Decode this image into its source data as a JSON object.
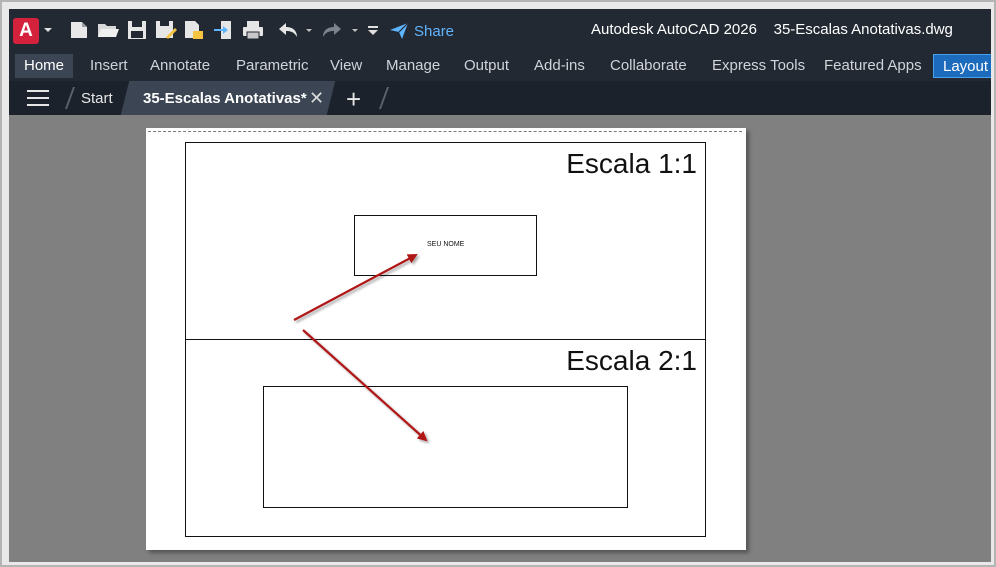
{
  "app": {
    "logo_letter": "A",
    "title": "Autodesk AutoCAD 2026",
    "filename": "35-Escalas Anotativas.dwg",
    "brand_color": "#d4223c",
    "accent_color": "#1c6bbd"
  },
  "quick_access": {
    "icons": [
      "new-file-icon",
      "open-folder-icon",
      "save-icon",
      "save-as-icon",
      "publish-icon",
      "import-icon",
      "print-icon",
      "undo-icon",
      "redo-icon",
      "customize-icon"
    ],
    "share_label": "Share"
  },
  "ribbon": {
    "tabs": [
      {
        "label": "Home"
      },
      {
        "label": "Insert"
      },
      {
        "label": "Annotate"
      },
      {
        "label": "Parametric"
      },
      {
        "label": "View"
      },
      {
        "label": "Manage"
      },
      {
        "label": "Output"
      },
      {
        "label": "Add-ins"
      },
      {
        "label": "Collaborate"
      },
      {
        "label": "Express Tools"
      },
      {
        "label": "Featured Apps"
      },
      {
        "label": "Layout"
      }
    ],
    "active_tab": "Home"
  },
  "file_tabs": {
    "start_label": "Start",
    "document_label": "35-Escalas Anotativas*",
    "close_glyph": "✕",
    "add_glyph": "+"
  },
  "drawing": {
    "viewport1_title": "Escala 1:1",
    "viewport2_title": "Escala 2:1",
    "name_field_text": "SEU NOME",
    "arrow_color": "#b01818"
  }
}
